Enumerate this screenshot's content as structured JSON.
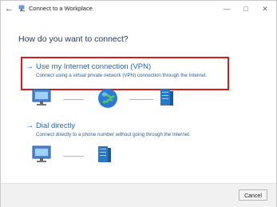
{
  "window": {
    "title": "Connect to a Workplace",
    "back_glyph": "←",
    "controls": [
      "—",
      "□",
      "✕"
    ]
  },
  "heading": "How do you want to connect?",
  "options": [
    {
      "title": "Use my Internet connection (VPN)",
      "description": "Connect using a virtual private network (VPN) connection through the Internet."
    },
    {
      "title": "Dial directly",
      "description": "Connect directly to a phone number without going through the Internet."
    }
  ],
  "buttons": {
    "cancel": "Cancel"
  },
  "icons": {
    "back": "back-arrow-icon",
    "app": "network-icon",
    "computer": "computer-icon",
    "globe": "globe-icon",
    "server": "server-icon",
    "option_arrow": "arrow-right-icon"
  },
  "colors": {
    "accent": "#1e66b5",
    "highlight_border": "#d81b1b"
  }
}
